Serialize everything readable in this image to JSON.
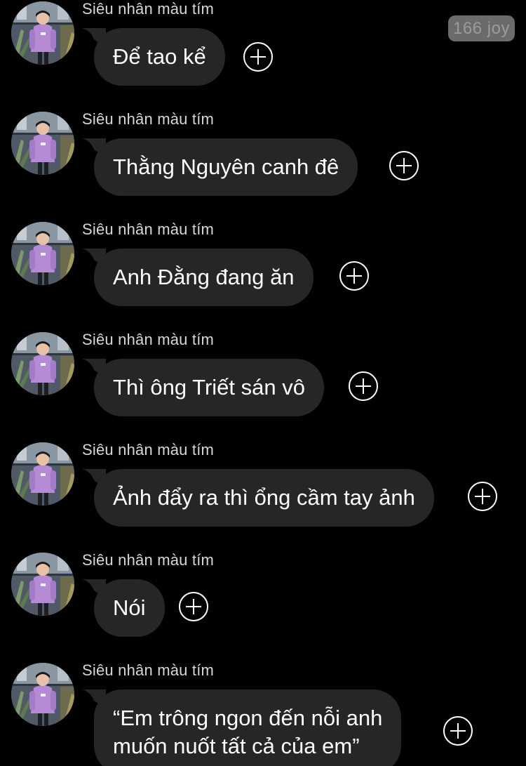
{
  "badge": {
    "label": "166 joy"
  },
  "messages": [
    {
      "sender": "Siêu nhân màu tím",
      "text": "Để tao kể",
      "avatar": "avatar-photo"
    },
    {
      "sender": "Siêu nhân màu tím",
      "text": "Thằng Nguyên canh đê",
      "avatar": "avatar-photo"
    },
    {
      "sender": "Siêu nhân màu tím",
      "text": "Anh Đằng đang ăn",
      "avatar": "avatar-photo"
    },
    {
      "sender": "Siêu nhân màu tím",
      "text": "Thì ông Triết sán vô",
      "avatar": "avatar-photo"
    },
    {
      "sender": "Siêu nhân màu tím",
      "text": "Ảnh đẩy ra thì ổng cầm tay ảnh",
      "avatar": "avatar-photo"
    },
    {
      "sender": "Siêu nhân màu tím",
      "text": "Nói",
      "avatar": "avatar-photo"
    },
    {
      "sender": "Siêu nhân màu tím",
      "text": "“Em trông ngon đến nỗi anh\nmuốn nuốt tất cả của em”",
      "avatar": "avatar-photo"
    }
  ],
  "icons": {
    "reaction": "add-reaction-icon"
  },
  "colors": {
    "background": "#000000",
    "bubble": "#262628",
    "message_text": "#ffffff",
    "sender_text": "#d7d7d9",
    "badge_bg": "#6b6b6e"
  }
}
